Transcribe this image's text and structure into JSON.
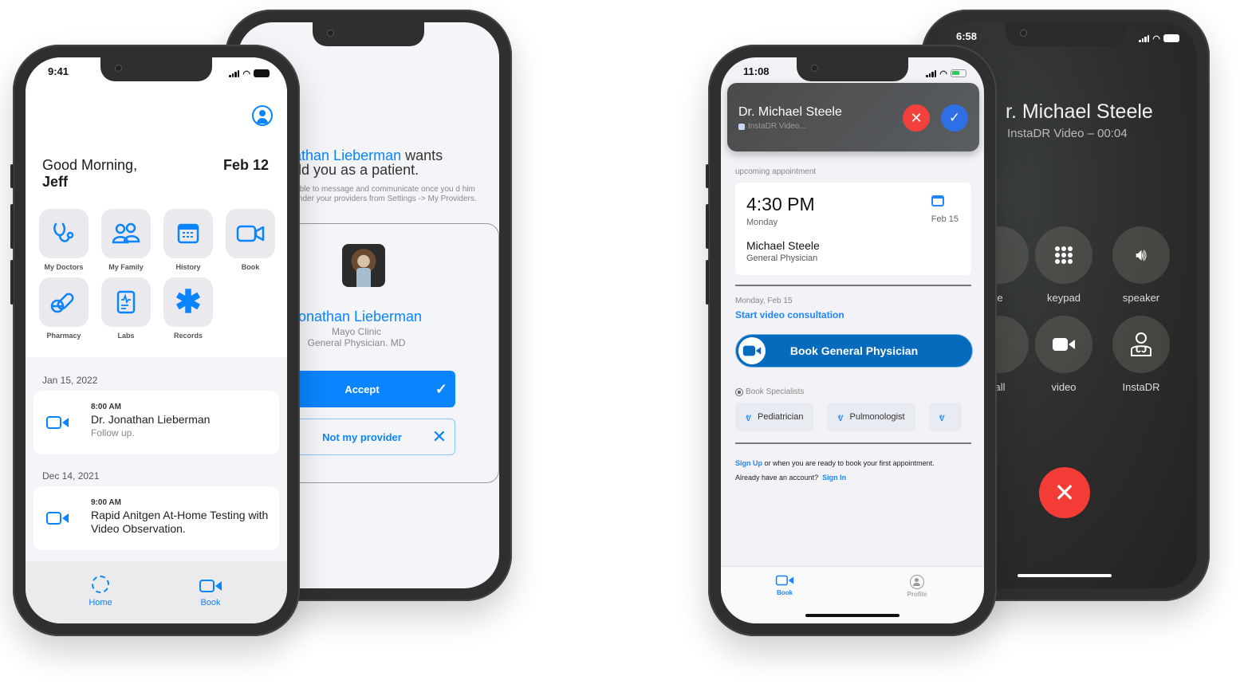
{
  "phone_home": {
    "status_time": "9:41",
    "greeting": "Good Morning,",
    "user_name": "Jeff",
    "date": "Feb 12",
    "tiles": [
      {
        "label": "My Doctors",
        "icon": "stethoscope-icon"
      },
      {
        "label": "My Family",
        "icon": "family-icon"
      },
      {
        "label": "History",
        "icon": "calendar-icon"
      },
      {
        "label": "Book",
        "icon": "video-icon"
      },
      {
        "label": "Pharmacy",
        "icon": "pills-icon"
      },
      {
        "label": "Labs",
        "icon": "lab-report-icon"
      },
      {
        "label": "Records",
        "icon": "asterisk-icon"
      }
    ],
    "appointments": [
      {
        "date": "Jan 15, 2022",
        "time": "8:00 AM",
        "title": "Dr. Jonathan Lieberman",
        "subtitle": "Follow up."
      },
      {
        "date": "Dec 14, 2021",
        "time": "9:00 AM",
        "title": "Rapid Anitgen At-Home Testing with Video Observation.",
        "subtitle": ""
      }
    ],
    "tabs": [
      {
        "label": "Home"
      },
      {
        "label": "Book"
      }
    ],
    "accent": "#0a84ff"
  },
  "phone_invite": {
    "heading_name": "nathan Lieberman",
    "heading_rest_1": " wants",
    "heading_rest_2": " add you as a patient.",
    "description": "able to message and communicate once you d him under your providers from Settings -> My Providers.",
    "doctor_name": "Jonathan Lieberman",
    "clinic": "Mayo Clinic",
    "specialty": "General Physician. MD",
    "accept_label": "Accept",
    "reject_label": "Not my provider"
  },
  "phone_booking": {
    "status_time": "11:08",
    "notification": {
      "caller": "Dr. Michael Steele",
      "app": "InstaDR Video...",
      "decline_color": "#f2403a",
      "accept_color": "#2f6fe5"
    },
    "upcoming_label": "upcoming appointment",
    "upcoming": {
      "time": "4:30 PM",
      "day": "Monday",
      "date": "Feb 15",
      "doctor": "Michael Steele",
      "specialty": "General Physician"
    },
    "consult_date": "Monday, Feb 15",
    "consult_link": "Start video consultation",
    "book_button": "Book General Physician",
    "specialists_label": "Book Specialists",
    "specialists": [
      "Pediatrician",
      "Pulmonologist",
      ""
    ],
    "signup_link": "Sign Up",
    "signup_text": " or when you are ready to book your first appointment.",
    "signin_prompt": "Already have an account?",
    "signin_link": "Sign In",
    "tabs": [
      {
        "label": "Book"
      },
      {
        "label": "Profile"
      }
    ]
  },
  "phone_call": {
    "status_time": "6:58",
    "caller": "r. Michael Steele",
    "subtitle": "InstaDR Video – 00:04",
    "buttons": [
      {
        "label": "e"
      },
      {
        "label": "keypad"
      },
      {
        "label": "speaker"
      },
      {
        "label": "all"
      },
      {
        "label": "video"
      },
      {
        "label": "InstaDR"
      }
    ],
    "end_color": "#f23c35"
  }
}
